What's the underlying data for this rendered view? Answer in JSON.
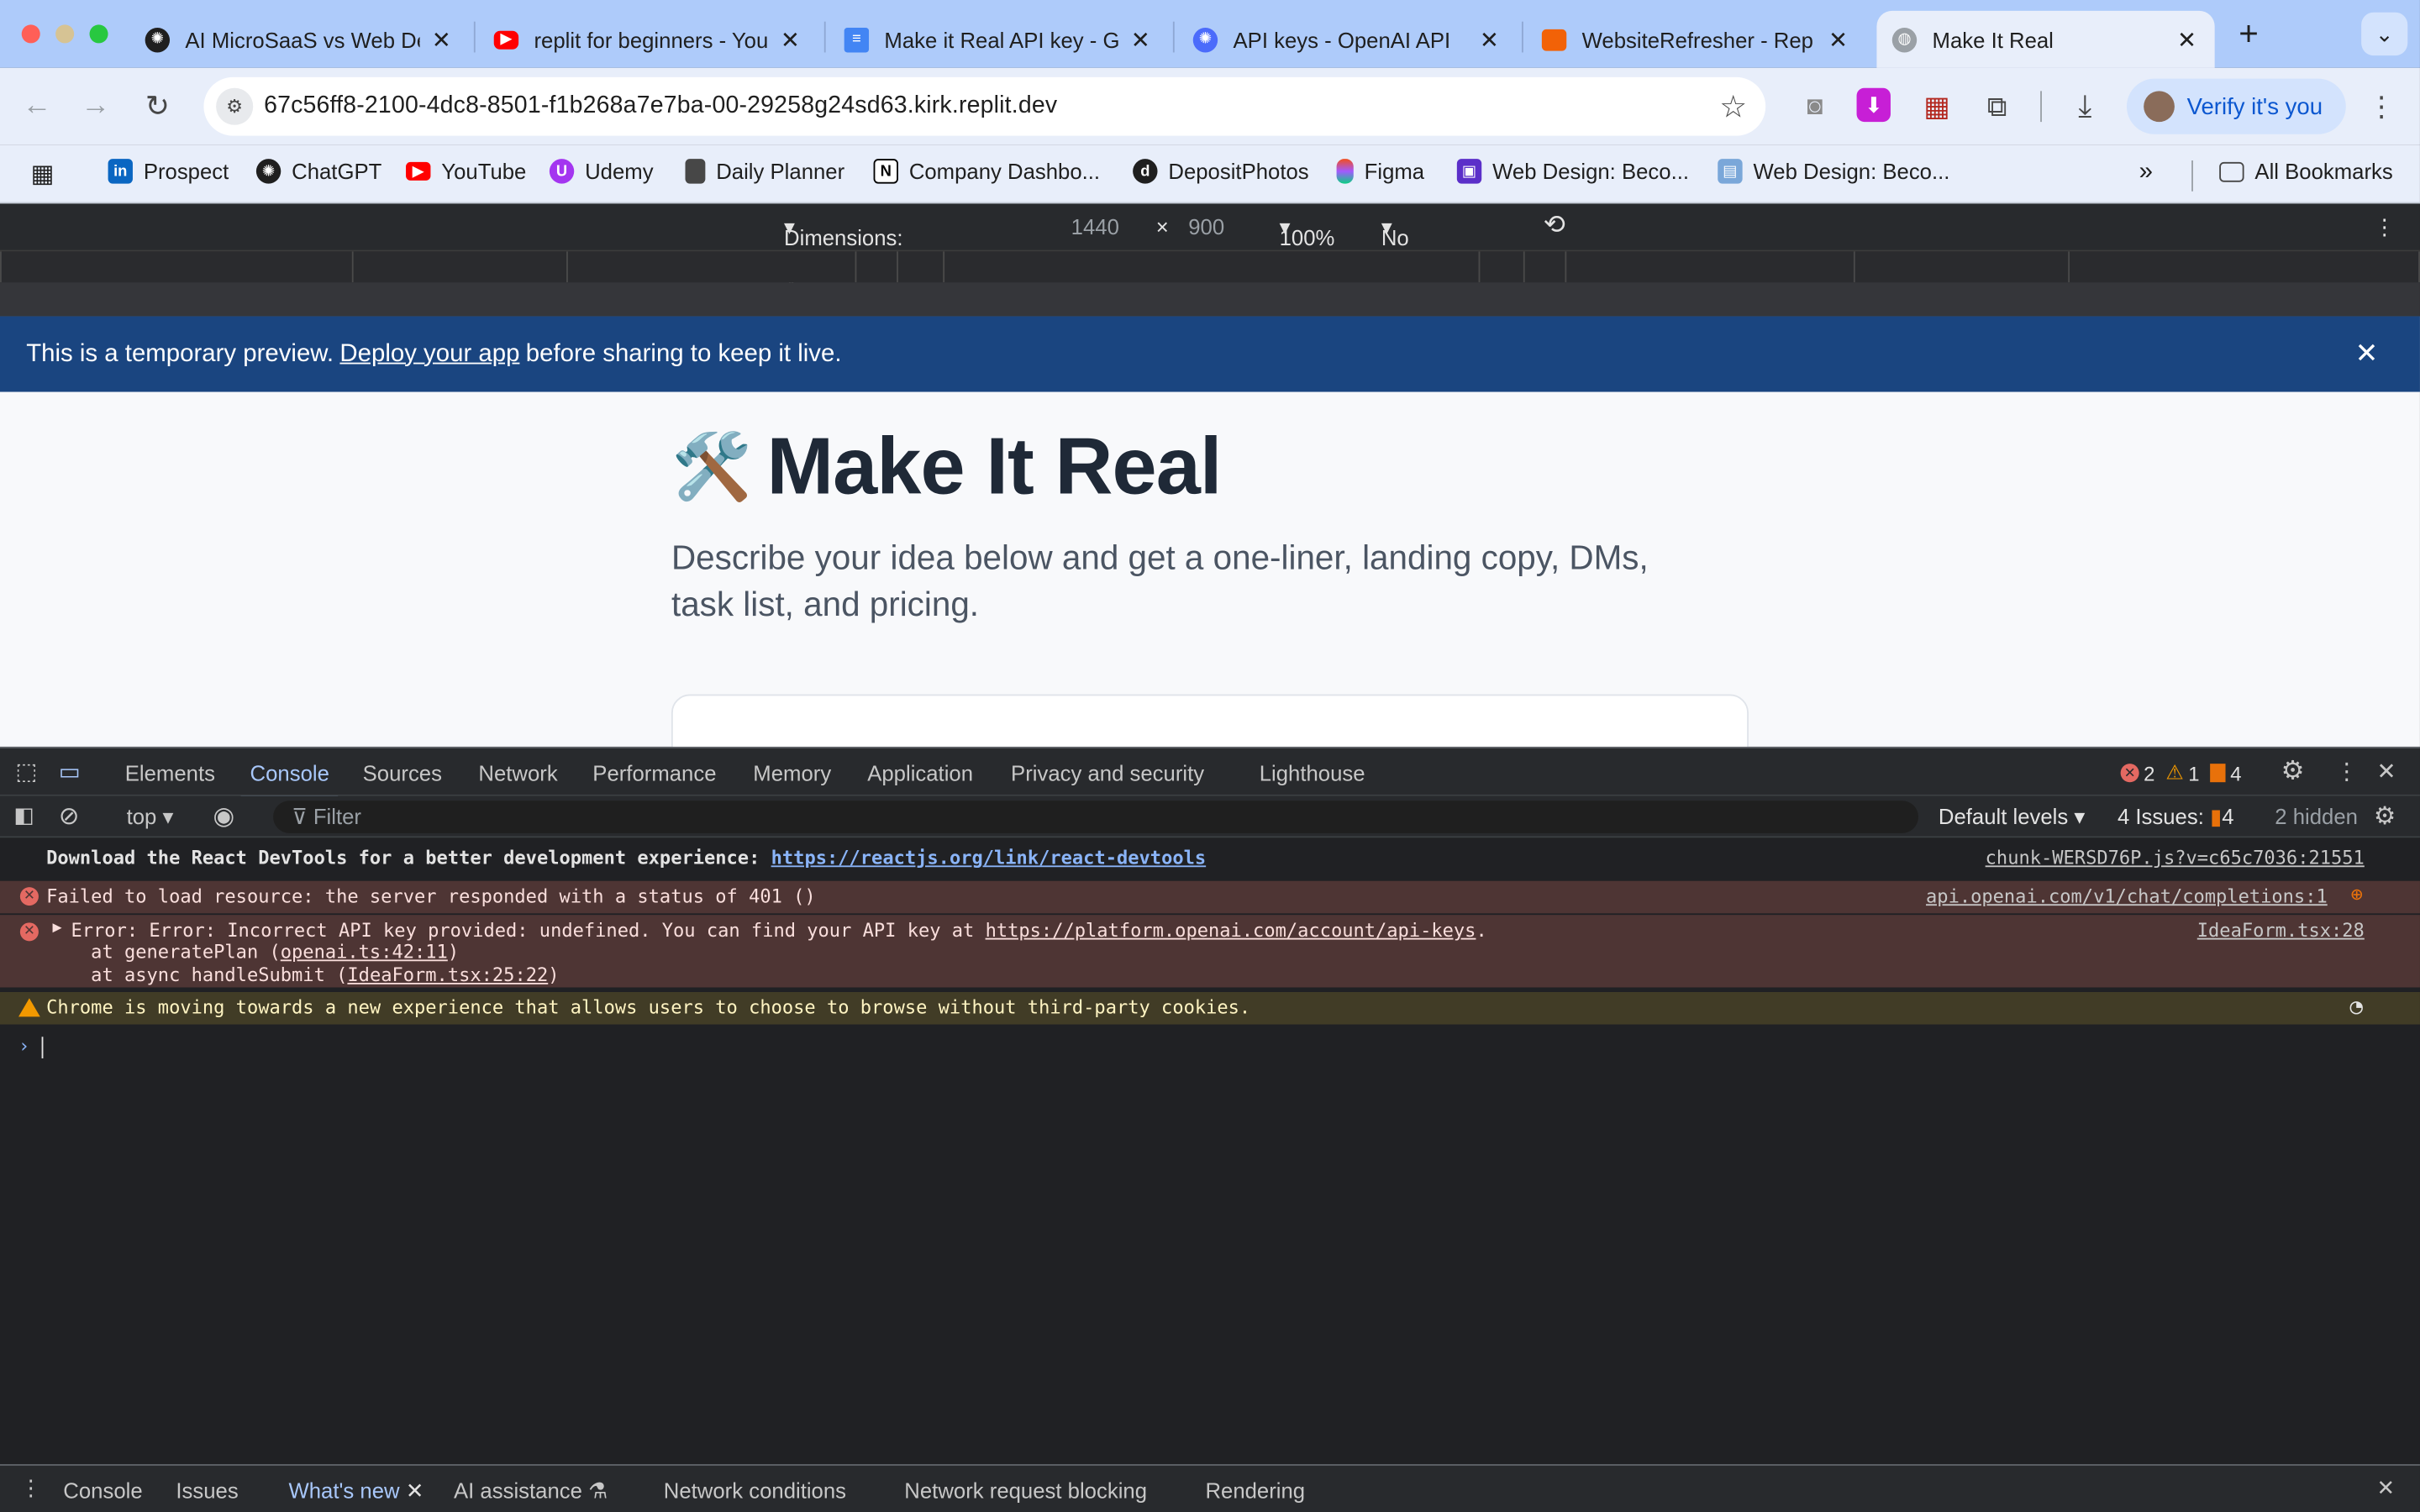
{
  "tabs": [
    {
      "title": "AI MicroSaaS vs Web De",
      "icon": "chatgpt-icon"
    },
    {
      "title": "replit for beginners - You",
      "icon": "youtube-icon"
    },
    {
      "title": "Make it Real API key - G",
      "icon": "google-docs-icon"
    },
    {
      "title": "API keys - OpenAI API",
      "icon": "openai-icon"
    },
    {
      "title": "WebsiteRefresher - Rep",
      "icon": "replit-icon"
    },
    {
      "title": "Make It Real",
      "icon": "globe-icon"
    }
  ],
  "omnibox": {
    "url": "67c56ff8-2100-4dc8-8501-f1b268a7e7ba-00-29258g24sd63.kirk.replit.dev"
  },
  "profile": {
    "label": "Verify it's you"
  },
  "bookmarks": [
    "Prospect",
    "ChatGPT",
    "YouTube",
    "Udemy",
    "Daily Planner",
    "Company Dashbo...",
    "DepositPhotos",
    "Figma",
    "Web Design: Beco...",
    "Web Design: Beco..."
  ],
  "all_bookmarks": "All Bookmarks",
  "device_toolbar": {
    "dimensions": "Dimensions: MacBook Air",
    "width": "1440",
    "times": "×",
    "height": "900",
    "zoom": "100%",
    "throttling": "No throttling"
  },
  "banner": {
    "before": "This is a temporary preview.",
    "link": "Deploy your app",
    "after": "before sharing to keep it live."
  },
  "hero": {
    "emoji": "🛠️",
    "title": "Make It Real",
    "subtitle": "Describe your idea below and get a one-liner, landing copy, DMs, task list, and pricing."
  },
  "devtools": {
    "tabs": [
      "Elements",
      "Console",
      "Sources",
      "Network",
      "Performance",
      "Memory",
      "Application",
      "Privacy and security",
      "Lighthouse"
    ],
    "active_tab": "Console",
    "errors": "2",
    "warnings": "1",
    "issues_badge": "4",
    "context": "top",
    "filter_placeholder": "Filter",
    "levels": "Default levels",
    "issues_label": "4 Issues:",
    "issues_count": "4",
    "hidden": "2 hidden"
  },
  "console": {
    "info": {
      "text": "Download the React DevTools for a better development experience: ",
      "link": "https://reactjs.org/link/react-devtools",
      "source": "chunk-WERSD76P.js?v=c65c7036:21551"
    },
    "error1": {
      "text": "Failed to load resource: the server responded with a status of 401 ()",
      "source": "api.openai.com/v1/chat/completions:1"
    },
    "error2": {
      "text": "Error: Error: Incorrect API key provided: undefined. You can find your API key at ",
      "link": "https://platform.openai.com/account/api-keys",
      "after": ".",
      "stack1_pre": "    at generatePlan (",
      "stack1_link": "openai.ts:42:11",
      "stack1_post": ")",
      "stack2_pre": "    at async handleSubmit (",
      "stack2_link": "IdeaForm.tsx:25:22",
      "stack2_post": ")",
      "source": "IdeaForm.tsx:28"
    },
    "warning": {
      "text": "Chrome is moving towards a new experience that allows users to choose to browse without third-party cookies."
    }
  },
  "drawer": {
    "tabs": [
      "Console",
      "Issues",
      "What's new",
      "AI assistance",
      "Network conditions",
      "Network request blocking",
      "Rendering"
    ],
    "active": "What's new"
  },
  "colors": {
    "banner": "#1a4580",
    "active_tab": "#a8c7fa",
    "error_bg": "#4e3534",
    "warning_bg": "#413c26"
  }
}
